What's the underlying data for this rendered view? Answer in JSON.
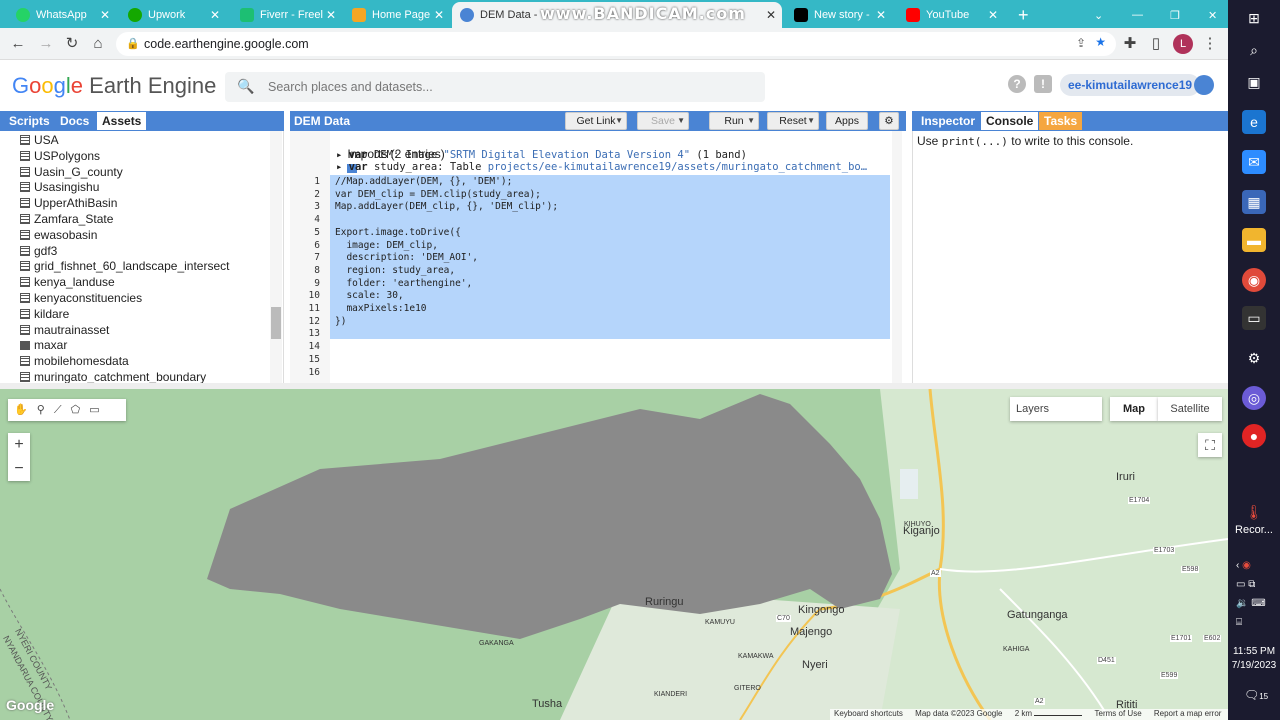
{
  "browser": {
    "tabs": [
      {
        "label": "WhatsApp",
        "color": "#25d366"
      },
      {
        "label": "Upwork",
        "color": "#14a800"
      },
      {
        "label": "Fiverr - Freel",
        "color": "#1dbf73"
      },
      {
        "label": "Home Page",
        "color": "#f5a623"
      },
      {
        "label": "DEM Data - ",
        "color": "#4a84d4"
      },
      {
        "label": "New story -",
        "color": "#000000"
      },
      {
        "label": "YouTube",
        "color": "#ff0000"
      }
    ],
    "overlay_text": "www.BANDICAM.com",
    "url": "code.earthengine.google.com"
  },
  "gee": {
    "logo_google": "Google",
    "logo_rest": "Earth Engine",
    "search_placeholder": "Search places and datasets...",
    "user": "ee-kimutailawrence19",
    "help_icon": "?",
    "left_tabs": [
      "Scripts",
      "Docs",
      "Assets"
    ],
    "assets": [
      {
        "name": "USA",
        "icon": "table"
      },
      {
        "name": "USPolygons",
        "icon": "table"
      },
      {
        "name": "Uasin_G_county",
        "icon": "table"
      },
      {
        "name": "Usasingishu",
        "icon": "table"
      },
      {
        "name": "UpperAthiBasin",
        "icon": "table"
      },
      {
        "name": "Zamfara_State",
        "icon": "table"
      },
      {
        "name": "ewasobasin",
        "icon": "table"
      },
      {
        "name": "gdf3",
        "icon": "table"
      },
      {
        "name": "grid_fishnet_60_landscape_intersect",
        "icon": "table"
      },
      {
        "name": "kenya_landuse",
        "icon": "table"
      },
      {
        "name": "kenyaconstituencies",
        "icon": "table"
      },
      {
        "name": "kildare",
        "icon": "table"
      },
      {
        "name": "mautrainasset",
        "icon": "table"
      },
      {
        "name": "maxar",
        "icon": "image"
      },
      {
        "name": "mobilehomesdata",
        "icon": "table"
      },
      {
        "name": "muringato_catchment_boundary",
        "icon": "table"
      }
    ],
    "editor": {
      "title": "DEM Data",
      "buttons": {
        "get_link": "Get Link",
        "save": "Save",
        "run": "Run",
        "reset": "Reset",
        "apps": "Apps"
      },
      "imports_header": "Imports (2 entries)",
      "import1_pre": "var ",
      "import1_name": "DEM",
      "import1_mid": ": Image ",
      "import1_value": "\"SRTM Digital Elevation Data Version 4\"",
      "import1_post": " (1 band)",
      "import2_pre": "var ",
      "import2_name": "study_area",
      "import2_mid": ": Table ",
      "import2_value": "projects/ee-kimutailawrence19/assets/muringato_catchment_bo…",
      "line_numbers": [
        "1",
        "2",
        "3",
        "4",
        "5",
        "6",
        "7",
        "8",
        "9",
        "10",
        "11",
        "12",
        "13",
        "14",
        "15",
        "16"
      ],
      "lines": [
        "//Map.addLayer(DEM, {}, 'DEM');",
        "var DEM_clip = DEM.clip(study_area);",
        "Map.addLayer(DEM_clip, {}, 'DEM_clip');",
        "",
        "Export.image.toDrive({",
        "  image: DEM_clip,",
        "  description: 'DEM_AOI',",
        "  folder: 'earthengine',",
        "  region: study_area,",
        "  scale: 30,",
        "  maxPixels:1e10",
        "})",
        "",
        "",
        "",
        ""
      ],
      "lines_display": [
        "//Map.addLayer(DEM, {}, 'DEM');",
        "var DEM_clip = DEM.clip(study_area);",
        "Map.addLayer(DEM_clip, {}, 'DEM_clip');",
        "",
        "Export.image.toDrive({",
        "  image: DEM_clip,",
        "  description: 'DEM_AOI',",
        "  region: study_area,",
        "  folder: 'earthengine',",
        "  scale: 30,",
        "  maxPixels:1e10",
        "})"
      ]
    },
    "right_tabs": [
      "Inspector",
      "Console",
      "Tasks"
    ],
    "console_pre": "Use ",
    "console_code": "print(...)",
    "console_post": " to write to this console."
  },
  "map": {
    "layers_label": "Layers",
    "map_label": "Map",
    "satellite_label": "Satellite",
    "zoom_in": "+",
    "zoom_out": "−",
    "places": [
      "Iruri",
      "KIHUYO",
      "Kiganjo",
      "Gatunganga",
      "Majengo",
      "Nyeri",
      "KAMAKWA",
      "GITERO",
      "KIANDERI",
      "Tusha",
      "GAKANGA",
      "KAMUYU",
      "Rititi",
      "KAHIGA",
      "Kingongo",
      "Ruringu"
    ],
    "road_labels": [
      "E1704",
      "E1703",
      "E598",
      "A2",
      "C70",
      "E1701",
      "E602",
      "D451",
      "E599",
      "A2"
    ],
    "county1": "NYERI COUNTY",
    "county2": "NYANDARUA COUNTY",
    "google_logo": "Google",
    "footer": [
      "Keyboard shortcuts",
      "Map data ©2023 Google",
      "2 km",
      "Terms of Use",
      "Report a map error"
    ]
  },
  "taskbar": {
    "recorder_label": "Recor...",
    "time": "11:55 PM",
    "date": "7/19/2023",
    "notif_count": "15"
  }
}
